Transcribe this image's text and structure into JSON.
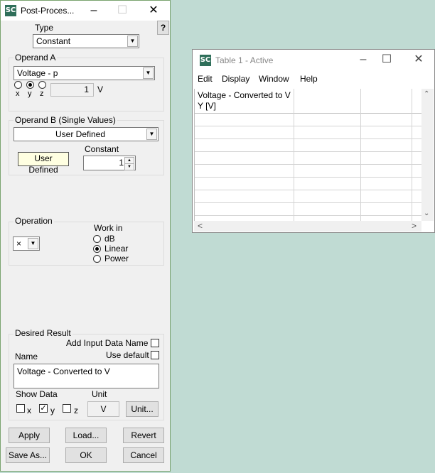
{
  "pp_window": {
    "title": "Post-Proces...",
    "icon": "SC",
    "help_label": "?",
    "type": {
      "label": "Type",
      "value": "Constant"
    },
    "operand_a": {
      "label": "Operand A",
      "value": "Voltage - p",
      "components": [
        "x",
        "y",
        "z"
      ],
      "selected_component": "y",
      "number": "1",
      "unit": "V"
    },
    "operand_b": {
      "label": "Operand B (Single Values)",
      "value": "User Defined",
      "tag": "User Defined",
      "constant_label": "Constant",
      "constant_value": "1"
    },
    "operation": {
      "label": "Operation",
      "value": "×",
      "work_in_label": "Work in",
      "options": [
        "dB",
        "Linear",
        "Power"
      ],
      "selected": "Linear"
    },
    "desired": {
      "label": "Desired Result",
      "add_input_label": "Add Input Data Name",
      "use_default_label": "Use default",
      "name_label": "Name",
      "name_value": "Voltage - Converted to V",
      "show_data_label": "Show Data",
      "unit_label": "Unit",
      "show": [
        {
          "label": "x",
          "checked": false
        },
        {
          "label": "y",
          "checked": true
        },
        {
          "label": "z",
          "checked": false
        }
      ],
      "unit_value": "V",
      "unit_button": "Unit..."
    },
    "buttons": {
      "apply": "Apply",
      "load": "Load...",
      "revert": "Revert",
      "save_as": "Save As...",
      "ok": "OK",
      "cancel": "Cancel"
    }
  },
  "table_window": {
    "title": "Table 1 - Active",
    "icon": "SC",
    "menu": [
      "Edit",
      "Display",
      "Window",
      "Help"
    ],
    "header_line1": "Voltage - Converted to V",
    "header_line2": "Y [V]"
  },
  "colors": {
    "desktop": "#c0dbd3",
    "window_border": "#7aa36f",
    "tooltip_bg": "#ffffe1"
  }
}
